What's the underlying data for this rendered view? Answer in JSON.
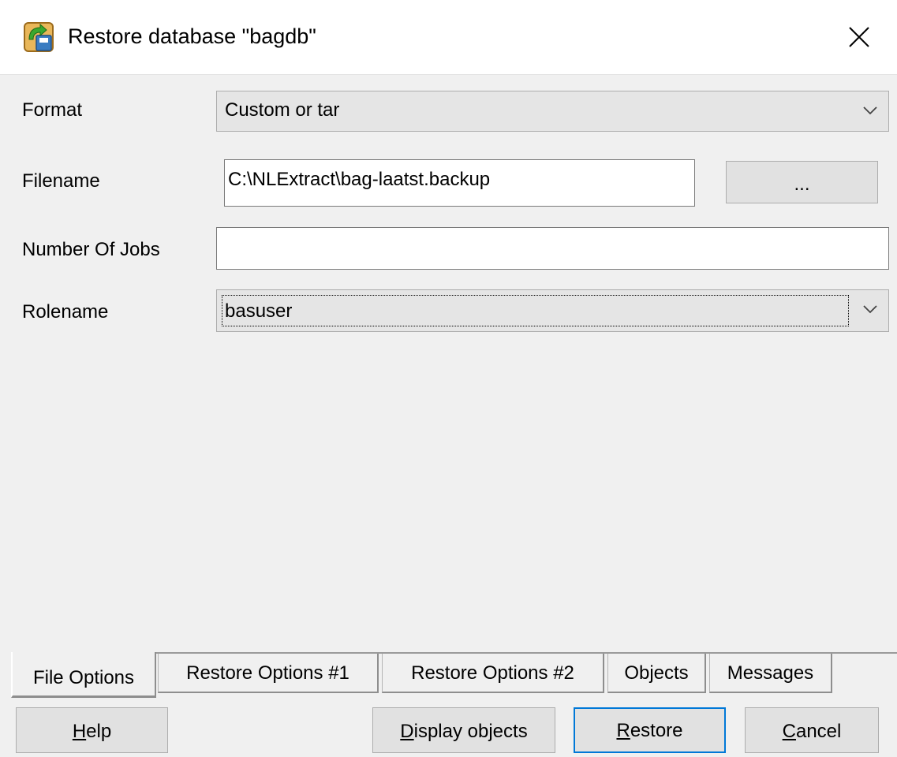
{
  "window": {
    "title": "Restore database \"bagdb\"",
    "icon": "restore-database-icon",
    "close_icon": "close-icon"
  },
  "form": {
    "format": {
      "label": "Format",
      "value": "Custom or tar"
    },
    "filename": {
      "label": "Filename",
      "value": "C:\\NLExtract\\bag-laatst.backup",
      "browse_label": "..."
    },
    "jobs": {
      "label": "Number Of Jobs",
      "value": ""
    },
    "rolename": {
      "label": "Rolename",
      "value": "basuser"
    }
  },
  "tabs": [
    {
      "label": "File Options",
      "active": true
    },
    {
      "label": "Restore Options #1"
    },
    {
      "label": "Restore Options #2"
    },
    {
      "label": "Objects"
    },
    {
      "label": "Messages"
    }
  ],
  "buttons": {
    "help": {
      "label": "Help",
      "accel": "H",
      "rest": "elp"
    },
    "display": {
      "label": "Display objects",
      "accel": "D",
      "rest": "isplay objects"
    },
    "restore": {
      "label": "Restore",
      "accel": "R",
      "rest": "estore"
    },
    "cancel": {
      "label": "Cancel",
      "accel": "C",
      "rest": "ancel"
    }
  },
  "colors": {
    "background": "#f0f0f0",
    "focus_border": "#0078d7"
  }
}
